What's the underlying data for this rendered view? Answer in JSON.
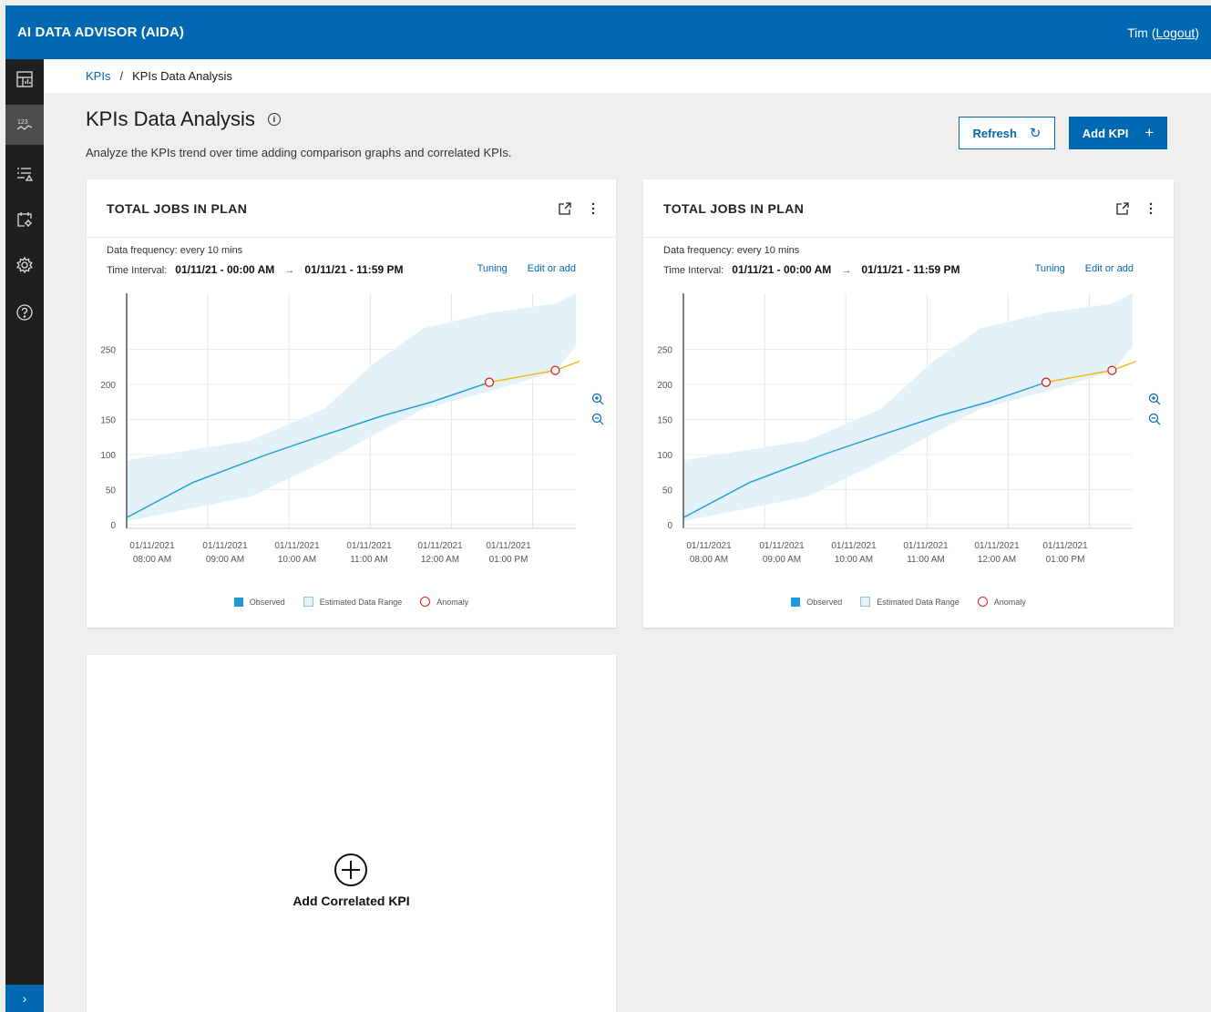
{
  "app": {
    "title": "AI DATA ADVISOR (AIDA)",
    "user": "Tim",
    "logout": "Logout"
  },
  "sidebar": {
    "items": [
      {
        "icon": "dashboard-icon"
      },
      {
        "icon": "kpi-trend-icon",
        "active": true
      },
      {
        "icon": "list-filter-icon"
      },
      {
        "icon": "calendar-settings-icon"
      },
      {
        "icon": "gear-icon"
      },
      {
        "icon": "help-icon"
      }
    ],
    "expand": "›"
  },
  "breadcrumb": {
    "root": "KPIs",
    "separator": "/",
    "current": "KPIs Data Analysis"
  },
  "page": {
    "title": "KPIs Data Analysis",
    "info": "i",
    "description": "Analyze the KPIs trend over time adding comparison graphs and correlated KPIs."
  },
  "toolbar": {
    "refresh_label": "Refresh",
    "refresh_icon": "↻",
    "add_label": "Add KPI",
    "add_icon": "+"
  },
  "cards": [
    {
      "title": "TOTAL JOBS IN PLAN",
      "frequency": "Data frequency: every 10 mins",
      "interval_label": "Time Interval:",
      "interval_start": "01/11/21 - 00:00 AM",
      "interval_arrow": "→",
      "interval_end": "01/11/21 - 11:59 PM",
      "tuning": "Tuning",
      "edit": "Edit or add"
    },
    {
      "title": "TOTAL JOBS IN PLAN",
      "frequency": "Data frequency: every 10 mins",
      "interval_label": "Time Interval:",
      "interval_start": "01/11/21 - 00:00 AM",
      "interval_arrow": "→",
      "interval_end": "01/11/21 - 11:59 PM",
      "tuning": "Tuning",
      "edit": "Edit or add"
    }
  ],
  "legend": {
    "observed": "Observed",
    "estimated": "Estimated Data Range",
    "anomaly": "Anomaly"
  },
  "add_correlated": {
    "label": "Add Correlated KPI"
  },
  "chart_data": [
    {
      "type": "line",
      "title": "TOTAL JOBS IN PLAN",
      "xlabel": "",
      "ylabel": "",
      "ylim": [
        0,
        250
      ],
      "yticks": [
        0,
        50,
        100,
        150,
        200,
        250
      ],
      "xticks": [
        [
          "01/11/2021",
          "08:00 AM"
        ],
        [
          "01/11/2021",
          "09:00 AM"
        ],
        [
          "01/11/2021",
          "10:00 AM"
        ],
        [
          "01/11/2021",
          "11:00 AM"
        ],
        [
          "01/11/2021",
          "12:00 AM"
        ],
        [
          "01/11/2021",
          "01:00 PM"
        ]
      ],
      "x_hours": [
        0,
        1,
        2,
        3,
        4,
        5,
        6
      ],
      "series": [
        {
          "name": "Observed",
          "color": "#1a9bd7",
          "x": [
            0,
            0.8,
            1.7,
            2.3,
            3.1,
            3.7,
            4.4
          ],
          "y": [
            10,
            60,
            100,
            124,
            155,
            175,
            203
          ]
        },
        {
          "name": "Anomaly",
          "color": "#f2b705",
          "x": [
            4.4,
            5.2,
            5.7
          ],
          "y": [
            203,
            220,
            233
          ]
        }
      ],
      "band": {
        "name": "Estimated Data Range",
        "color": "#e3f1f8",
        "x": [
          0,
          1.5,
          2.4,
          3.0,
          3.6,
          4.4,
          5.2,
          5.8
        ],
        "upper": [
          92,
          120,
          165,
          230,
          280,
          302,
          315,
          330
        ],
        "lower": [
          5,
          40,
          90,
          128,
          165,
          190,
          218,
          255
        ]
      },
      "anomalies": [
        {
          "x": 4.4,
          "y": 203
        },
        {
          "x": 5.2,
          "y": 220
        }
      ],
      "grid": true,
      "legend_position": "bottom"
    },
    {
      "type": "line",
      "title": "TOTAL JOBS IN PLAN",
      "xlabel": "",
      "ylabel": "",
      "ylim": [
        0,
        250
      ],
      "yticks": [
        0,
        50,
        100,
        150,
        200,
        250
      ],
      "xticks": [
        [
          "01/11/2021",
          "08:00 AM"
        ],
        [
          "01/11/2021",
          "09:00 AM"
        ],
        [
          "01/11/2021",
          "10:00 AM"
        ],
        [
          "01/11/2021",
          "11:00 AM"
        ],
        [
          "01/11/2021",
          "12:00 AM"
        ],
        [
          "01/11/2021",
          "01:00 PM"
        ]
      ],
      "x_hours": [
        0,
        1,
        2,
        3,
        4,
        5,
        6
      ],
      "series": [
        {
          "name": "Observed",
          "color": "#1a9bd7",
          "x": [
            0,
            0.8,
            1.7,
            2.3,
            3.1,
            3.7,
            4.4
          ],
          "y": [
            10,
            60,
            100,
            124,
            155,
            175,
            203
          ]
        },
        {
          "name": "Anomaly",
          "color": "#f2b705",
          "x": [
            4.4,
            5.2,
            5.7
          ],
          "y": [
            203,
            220,
            233
          ]
        }
      ],
      "band": {
        "name": "Estimated Data Range",
        "color": "#e3f1f8",
        "x": [
          0,
          1.5,
          2.4,
          3.0,
          3.6,
          4.4,
          5.2,
          5.8
        ],
        "upper": [
          92,
          120,
          165,
          230,
          280,
          302,
          315,
          330
        ],
        "lower": [
          5,
          40,
          90,
          128,
          165,
          190,
          218,
          255
        ]
      },
      "anomalies": [
        {
          "x": 4.4,
          "y": 203
        },
        {
          "x": 5.2,
          "y": 220
        }
      ],
      "grid": true,
      "legend_position": "bottom"
    }
  ]
}
